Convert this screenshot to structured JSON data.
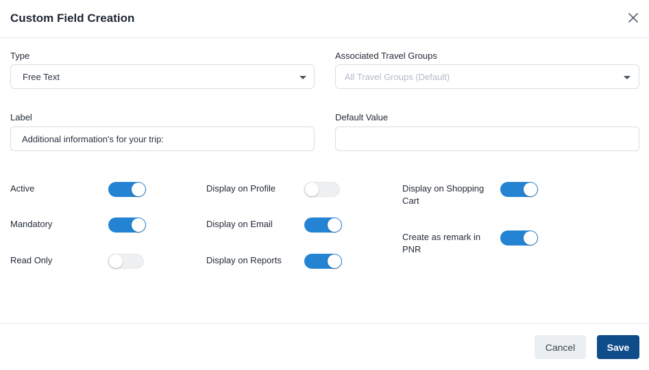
{
  "modal": {
    "title": "Custom Field Creation"
  },
  "form": {
    "type": {
      "label": "Type",
      "value": "Free Text"
    },
    "travel_groups": {
      "label": "Associated Travel Groups",
      "placeholder": "All Travel Groups (Default)"
    },
    "label_field": {
      "label": "Label",
      "value": "Additional information's for your trip:"
    },
    "default_value": {
      "label": "Default Value",
      "value": ""
    }
  },
  "toggles": {
    "active": {
      "label": "Active",
      "on": true
    },
    "mandatory": {
      "label": "Mandatory",
      "on": true
    },
    "read_only": {
      "label": "Read Only",
      "on": false
    },
    "display_profile": {
      "label": "Display on Profile",
      "on": false
    },
    "display_email": {
      "label": "Display on Email",
      "on": true
    },
    "display_reports": {
      "label": "Display on Reports",
      "on": true
    },
    "display_cart": {
      "label": "Display on Shopping Cart",
      "on": true
    },
    "remark_pnr": {
      "label": "Create as remark in PNR",
      "on": true
    }
  },
  "footer": {
    "cancel_label": "Cancel",
    "save_label": "Save"
  },
  "colors": {
    "toggle_on": "#2483d3",
    "save_button": "#0f4c8a"
  },
  "icons": {
    "close": "close-icon",
    "caret": "chevron-down-icon"
  }
}
